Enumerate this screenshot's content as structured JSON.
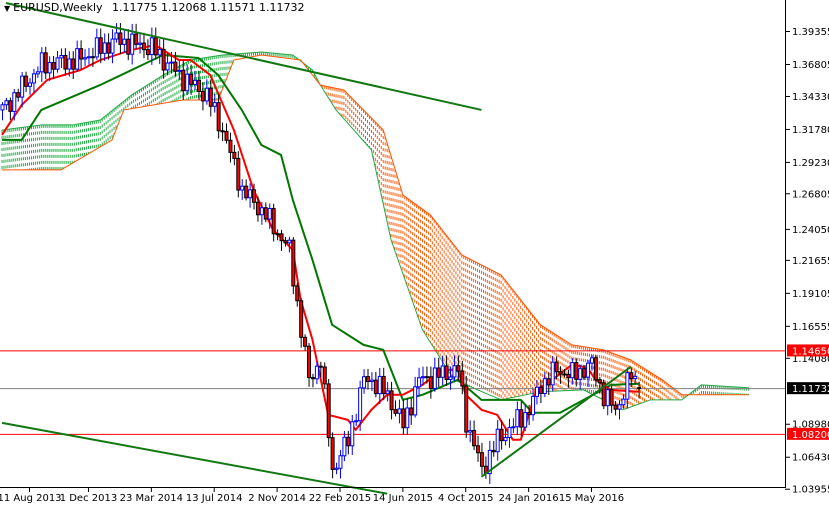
{
  "header": {
    "symbol_timeframe": "EURUSD,Weekly",
    "open": "1.11775",
    "high": "1.12068",
    "low": "1.11571",
    "close": "1.11732"
  },
  "colors": {
    "bull": "#0000ff",
    "bear": "#ff0000",
    "tenkan": "#ff0000",
    "kijun": "#007700",
    "cloud_bull": "#22aa44",
    "cloud_bear": "#ff5500",
    "trendline": "#117711",
    "hline_red": "#ff0000",
    "hline_gray": "#808080"
  },
  "chart_data": {
    "type": "candlestick",
    "title": "EURUSD,Weekly",
    "ylim": [
      1.034,
      1.4152
    ],
    "y_ticks": [
      "1.39355",
      "1.36805",
      "1.34330",
      "1.31780",
      "1.29230",
      "1.26805",
      "1.24050",
      "1.21655",
      "1.19105",
      "1.16555",
      "1.14080",
      "1.08980",
      "1.06430",
      "1.03955"
    ],
    "x_ticks": [
      {
        "week": 7,
        "label": "11 Aug 2013"
      },
      {
        "week": 22,
        "label": "1 Dec 2013"
      },
      {
        "week": 38,
        "label": "23 Mar 2014"
      },
      {
        "week": 54,
        "label": "13 Jul 2014"
      },
      {
        "week": 70,
        "label": "2 Nov 2014"
      },
      {
        "week": 86,
        "label": "22 Feb 2015"
      },
      {
        "week": 102,
        "label": "14 Jun 2015"
      },
      {
        "week": 118,
        "label": "4 Oct 2015"
      },
      {
        "week": 134,
        "label": "24 Jan 2016"
      },
      {
        "week": 150,
        "label": "15 May 2016"
      }
    ],
    "price_labels": [
      {
        "value": 1.1465,
        "label": "1.14650",
        "kind": "red"
      },
      {
        "value": 1.11732,
        "label": "1.11732",
        "kind": "current"
      },
      {
        "value": 1.082,
        "label": "1.08200",
        "kind": "red"
      }
    ],
    "close_path": [
      [
        0,
        1.3325
      ],
      [
        10,
        1.3673
      ],
      [
        19,
        1.3711
      ],
      [
        29,
        1.3866
      ],
      [
        38,
        1.3804
      ],
      [
        45,
        1.3595
      ],
      [
        52,
        1.3441
      ],
      [
        56,
        1.317
      ],
      [
        61,
        1.2706
      ],
      [
        67,
        1.2513
      ],
      [
        73,
        1.2242
      ],
      [
        76,
        1.1623
      ],
      [
        78,
        1.1236
      ],
      [
        81,
        1.1391
      ],
      [
        84,
        1.054
      ],
      [
        88,
        1.0772
      ],
      [
        92,
        1.1236
      ],
      [
        94,
        1.1236
      ],
      [
        98,
        1.112
      ],
      [
        102,
        1.0888
      ],
      [
        106,
        1.1236
      ],
      [
        111,
        1.1275
      ],
      [
        116,
        1.1314
      ],
      [
        118,
        1.0926
      ],
      [
        122,
        1.054
      ],
      [
        126,
        1.0772
      ],
      [
        130,
        1.0888
      ],
      [
        134,
        1.1004
      ],
      [
        137,
        1.1198
      ],
      [
        141,
        1.1314
      ],
      [
        145,
        1.1275
      ],
      [
        150,
        1.1353
      ],
      [
        153,
        1.112
      ],
      [
        156,
        1.1004
      ],
      [
        160,
        1.1275
      ],
      [
        162,
        1.1173
      ]
    ],
    "tenkan_sen": [
      [
        0,
        1.3132
      ],
      [
        5,
        1.3363
      ],
      [
        11.5,
        1.3557
      ],
      [
        20,
        1.3634
      ],
      [
        25,
        1.3711
      ],
      [
        33,
        1.3789
      ],
      [
        39,
        1.3827
      ],
      [
        45,
        1.3711
      ],
      [
        48,
        1.3711
      ],
      [
        53,
        1.3595
      ],
      [
        59,
        1.317
      ],
      [
        64,
        1.2706
      ],
      [
        69,
        1.2397
      ],
      [
        74,
        1.2242
      ],
      [
        76,
        1.1856
      ],
      [
        79,
        1.1547
      ],
      [
        83,
        1.0967
      ],
      [
        88,
        1.0928
      ],
      [
        90,
        1.0851
      ],
      [
        94,
        1.1006
      ],
      [
        98,
        1.1122
      ],
      [
        102,
        1.1122
      ],
      [
        107,
        1.1199
      ],
      [
        112,
        1.1315
      ],
      [
        116,
        1.1315
      ],
      [
        118,
        1.1122
      ],
      [
        122,
        1.1006
      ],
      [
        126,
        1.0967
      ],
      [
        130,
        1.0774
      ],
      [
        132,
        1.0774
      ],
      [
        136,
        1.116
      ],
      [
        140,
        1.1238
      ],
      [
        145,
        1.1354
      ],
      [
        149,
        1.1331
      ],
      [
        151,
        1.1238
      ],
      [
        155,
        1.116
      ],
      [
        162,
        1.1145
      ]
    ],
    "kijun_sen": [
      [
        0,
        1.3093
      ],
      [
        5,
        1.3093
      ],
      [
        10,
        1.3325
      ],
      [
        25,
        1.3518
      ],
      [
        33,
        1.3634
      ],
      [
        41,
        1.375
      ],
      [
        50,
        1.3727
      ],
      [
        55,
        1.3595
      ],
      [
        61,
        1.3325
      ],
      [
        66,
        1.3054
      ],
      [
        71,
        1.2977
      ],
      [
        74,
        1.2629
      ],
      [
        79,
        1.2165
      ],
      [
        84,
        1.1663
      ],
      [
        92,
        1.1508
      ],
      [
        97,
        1.147
      ],
      [
        102,
        1.1083
      ],
      [
        107,
        1.1122
      ],
      [
        116,
        1.1238
      ],
      [
        122,
        1.1083
      ],
      [
        132,
        1.1083
      ],
      [
        135,
        1.0983
      ],
      [
        142,
        1.0983
      ],
      [
        148,
        1.1083
      ],
      [
        155,
        1.1199
      ],
      [
        162,
        1.1207
      ]
    ],
    "senkou_span_a": [
      [
        0,
        1.317
      ],
      [
        10,
        1.3209
      ],
      [
        18,
        1.3209
      ],
      [
        25,
        1.3247
      ],
      [
        33,
        1.3441
      ],
      [
        41,
        1.3595
      ],
      [
        48,
        1.3711
      ],
      [
        56,
        1.375
      ],
      [
        66,
        1.3773
      ],
      [
        74,
        1.375
      ],
      [
        79,
        1.3634
      ],
      [
        81,
        1.3518
      ],
      [
        85,
        1.3325
      ],
      [
        94,
        1.3016
      ],
      [
        99,
        1.232
      ],
      [
        107,
        1.1624
      ],
      [
        115,
        1.1238
      ],
      [
        127,
        1.1083
      ],
      [
        137,
        1.1145
      ],
      [
        148,
        1.116
      ],
      [
        158,
        1.1006
      ],
      [
        165,
        1.1083
      ],
      [
        173,
        1.1083
      ],
      [
        178,
        1.1199
      ],
      [
        190,
        1.1176
      ]
    ],
    "senkou_span_b": [
      [
        0,
        1.2861
      ],
      [
        15,
        1.2861
      ],
      [
        28,
        1.3093
      ],
      [
        31,
        1.3325
      ],
      [
        46,
        1.3402
      ],
      [
        55,
        1.3402
      ],
      [
        59,
        1.3711
      ],
      [
        66,
        1.375
      ],
      [
        76,
        1.3711
      ],
      [
        81,
        1.3518
      ],
      [
        87,
        1.3479
      ],
      [
        97,
        1.317
      ],
      [
        102,
        1.2668
      ],
      [
        109,
        1.2513
      ],
      [
        117,
        1.2204
      ],
      [
        127,
        1.2049
      ],
      [
        137,
        1.1663
      ],
      [
        145,
        1.1508
      ],
      [
        153,
        1.147
      ],
      [
        160,
        1.1392
      ],
      [
        168,
        1.1238
      ],
      [
        173,
        1.1122
      ],
      [
        178,
        1.1122
      ],
      [
        190,
        1.1122
      ]
    ],
    "trendlines": [
      {
        "name": "upper-descending",
        "from": [
          1,
          1.4152
        ],
        "to": [
          122,
          1.3325
        ]
      },
      {
        "name": "lower-descending",
        "from": [
          0,
          1.0905
        ],
        "to": [
          98,
          1.0357
        ]
      },
      {
        "name": "rising-support",
        "from": [
          122,
          1.0488
        ],
        "to": [
          160,
          1.1338
        ]
      }
    ]
  }
}
